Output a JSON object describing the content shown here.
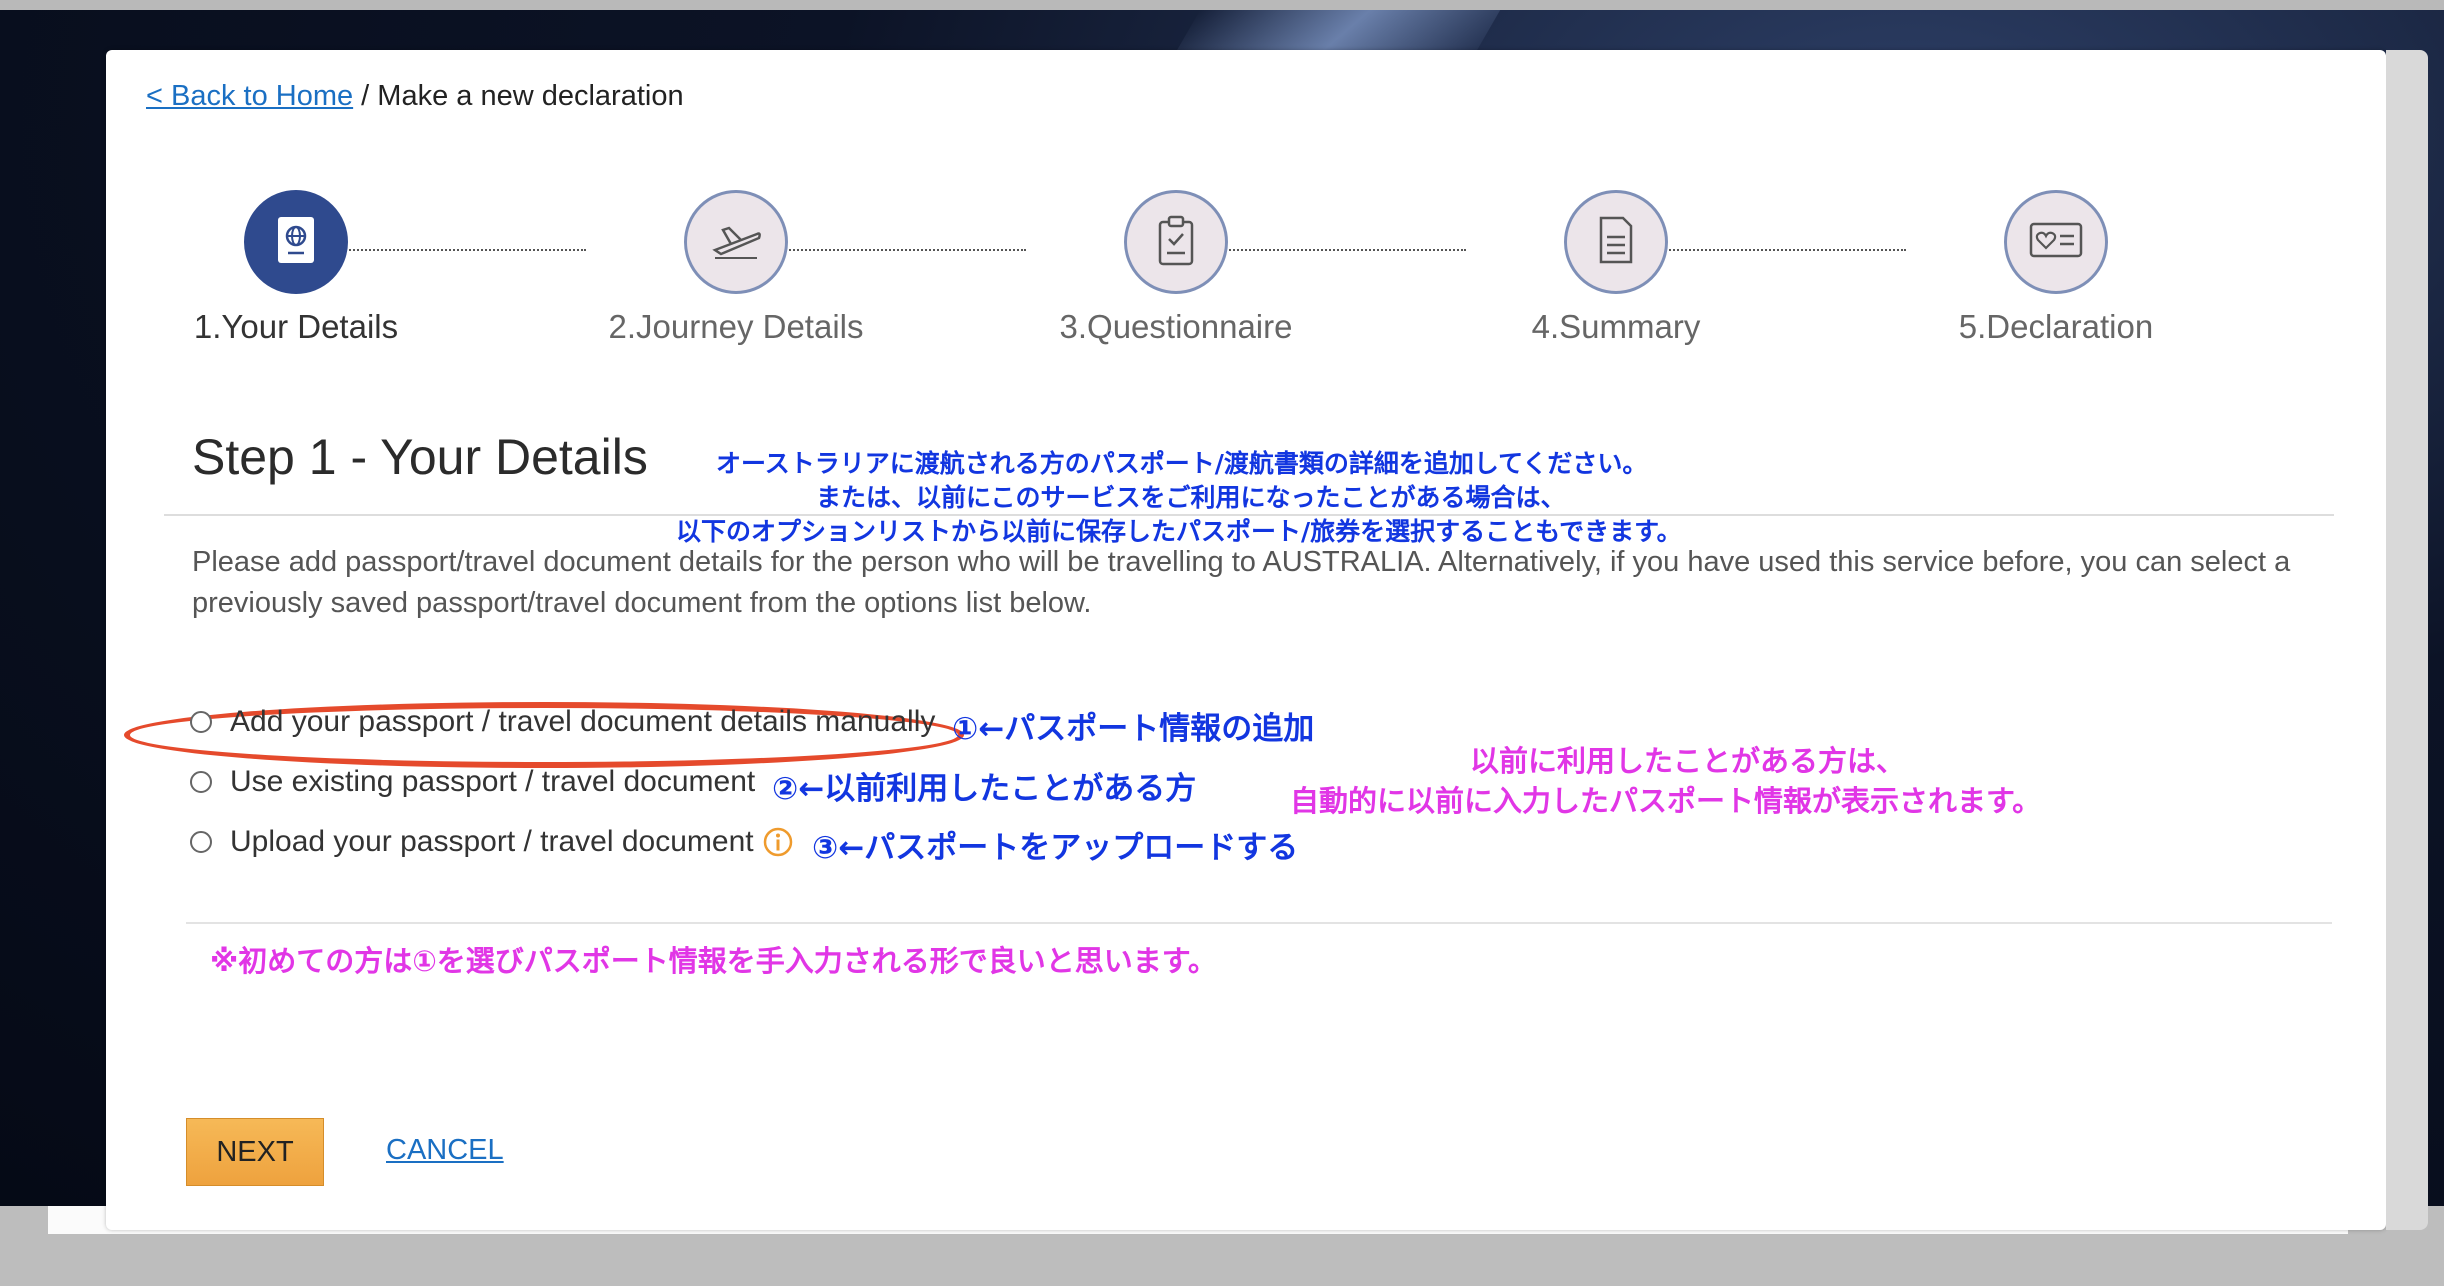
{
  "breadcrumb": {
    "back_link": "< Back to Home",
    "separator": " / ",
    "current": "Make a new declaration"
  },
  "steps": [
    {
      "label": "1.Your Details",
      "icon": "passport-icon",
      "active": true
    },
    {
      "label": "2.Journey Details",
      "icon": "airplane-icon",
      "active": false
    },
    {
      "label": "3.Questionnaire",
      "icon": "clipboard-icon",
      "active": false
    },
    {
      "label": "4.Summary",
      "icon": "document-icon",
      "active": false
    },
    {
      "label": "5.Declaration",
      "icon": "heart-card-icon",
      "active": false
    }
  ],
  "main": {
    "title": "Step 1 - Your Details",
    "description": "Please add passport/travel document details for the person who will be travelling to AUSTRALIA. Alternatively, if you have used this service before, you can select a previously saved passport/travel document from the options list below.",
    "options": [
      "Add your passport / travel document details manually",
      "Use existing passport / travel document",
      "Upload your passport / travel document"
    ]
  },
  "annotations": {
    "jp_intro": [
      "オーストラリアに渡航される方のパスポート/渡航書類の詳細を追加してください。",
      "または、以前にこのサービスをご利用になったことがある場合は、",
      "以下のオプションリストから以前に保存したパスポート/旅券を選択することもできます。"
    ],
    "opt1_note": "①←パスポート情報の追加",
    "opt2_note": "②←以前利用したことがある方",
    "opt3_note": "③←パスポートをアップロードする",
    "existing_note": [
      "以前に利用したことがある方は、",
      "自動的に以前に入力したパスポート情報が表示されます。"
    ],
    "first_time_note": "※初めての方は①を選びパスポート情報を手入力される形で良いと思います。"
  },
  "buttons": {
    "next": "NEXT",
    "cancel": "CANCEL"
  },
  "colors": {
    "step_active": "#2f4a8e",
    "step_inactive_fill": "#ece5ea",
    "link": "#1a6fc3",
    "next_button": "#f2ad4a",
    "annotation_blue": "#1236e0",
    "annotation_pink": "#e136e6",
    "highlight_oval": "#e54a2c"
  }
}
